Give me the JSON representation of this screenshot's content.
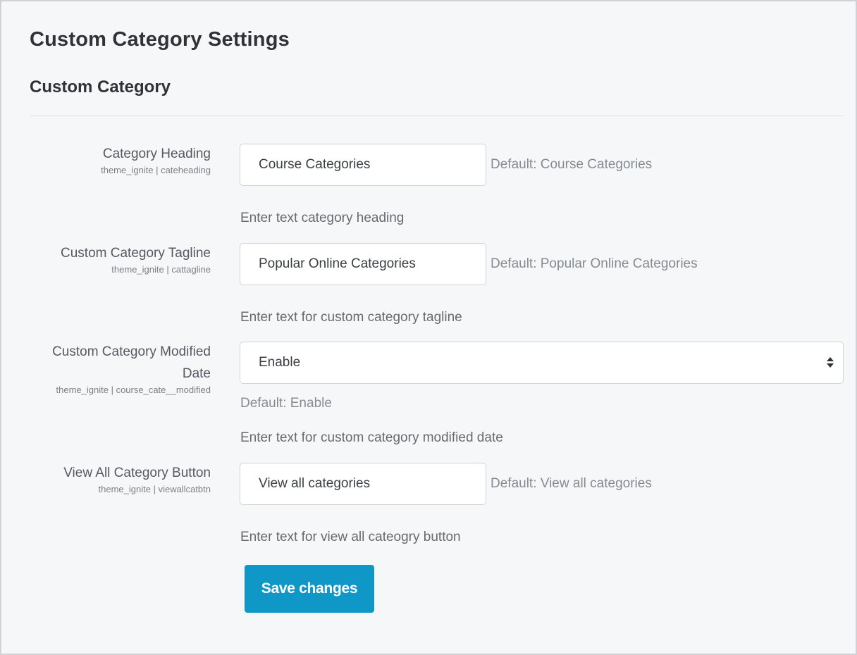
{
  "page": {
    "title": "Custom Category Settings",
    "section_title": "Custom Category"
  },
  "settings": [
    {
      "label": "Category Heading",
      "setting_id": "theme_ignite | cateheading",
      "value": "Course Categories",
      "default": "Default: Course Categories",
      "help": "Enter text category heading"
    },
    {
      "label": "Custom Category Tagline",
      "setting_id": "theme_ignite | cattagline",
      "value": "Popular Online Categories",
      "default": "Default: Popular Online Categories",
      "help": "Enter text for custom category tagline"
    },
    {
      "label_line1": "Custom Category Modified",
      "label_line2": "Date",
      "setting_id": "theme_ignite | course_cate__modified",
      "value": "Enable",
      "default": "Default: Enable",
      "help": "Enter text for custom category modified date"
    },
    {
      "label": "View All Category Button",
      "setting_id": "theme_ignite | viewallcatbtn",
      "value": "View all categories",
      "default": "Default: View all categories",
      "help": "Enter text for view all cateogry button"
    }
  ],
  "actions": {
    "save_label": "Save changes"
  },
  "colors": {
    "accent": "#0f97c7",
    "background": "#f6f7f9"
  },
  "icons": {
    "select": "select-updown-arrows-icon"
  }
}
